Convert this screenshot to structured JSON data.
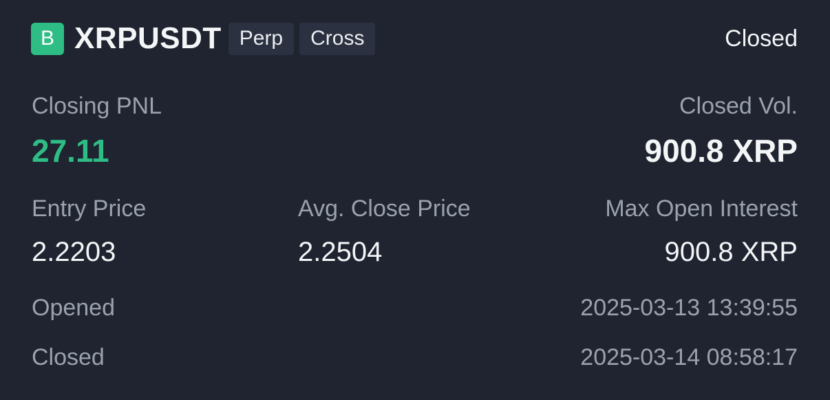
{
  "header": {
    "side_badge": "B",
    "symbol": "XRPUSDT",
    "tags": [
      "Perp",
      "Cross"
    ],
    "status": "Closed"
  },
  "summary": {
    "closing_pnl_label": "Closing PNL",
    "closing_pnl_value": "27.11",
    "closed_vol_label": "Closed Vol.",
    "closed_vol_value": "900.8 XRP"
  },
  "prices": {
    "entry_price_label": "Entry Price",
    "entry_price_value": "2.2203",
    "avg_close_price_label": "Avg. Close Price",
    "avg_close_price_value": "2.2504",
    "max_open_interest_label": "Max Open Interest",
    "max_open_interest_value": "900.8 XRP"
  },
  "times": {
    "opened_label": "Opened",
    "opened_value": "2025-03-13 13:39:55",
    "closed_label": "Closed",
    "closed_value": "2025-03-14 08:58:17"
  },
  "colors": {
    "background": "#1f2430",
    "profit_green": "#2ebd85",
    "tag_background": "#2b3140",
    "muted_text": "#9ba2ad",
    "primary_text": "#f3f5f7"
  }
}
